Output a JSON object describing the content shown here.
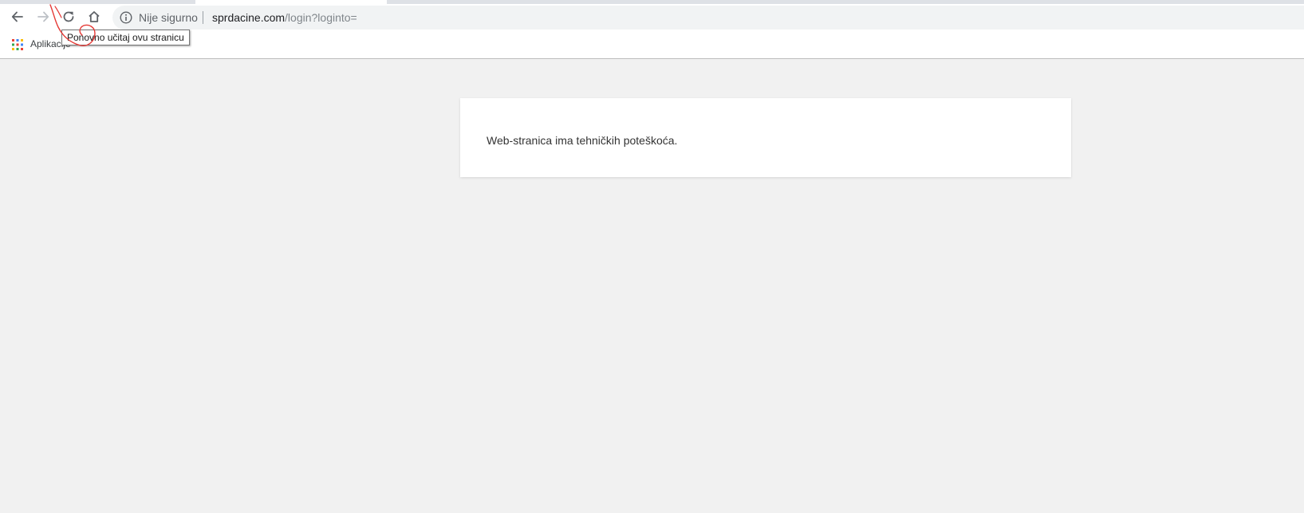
{
  "browser": {
    "omnibox": {
      "security_label": "Nije sigurno",
      "url_host": "sprdacine.com",
      "url_path": "/login?loginto="
    },
    "tooltip": {
      "text": "Ponovno učitaj ovu stranicu"
    },
    "bookmarks": {
      "apps_label": "Aplikacije"
    },
    "icons": {
      "back": "arrow-left-icon",
      "forward": "arrow-right-icon",
      "reload": "reload-icon",
      "home": "home-icon",
      "info": "info-icon",
      "apps": "apps-grid-icon"
    }
  },
  "page": {
    "error_message": "Web-stranica ima tehničkih poteškoća."
  },
  "colors": {
    "page_background": "#f1f1f1",
    "omnibox_background": "#f1f3f4",
    "annotation_red": "#e53935"
  }
}
